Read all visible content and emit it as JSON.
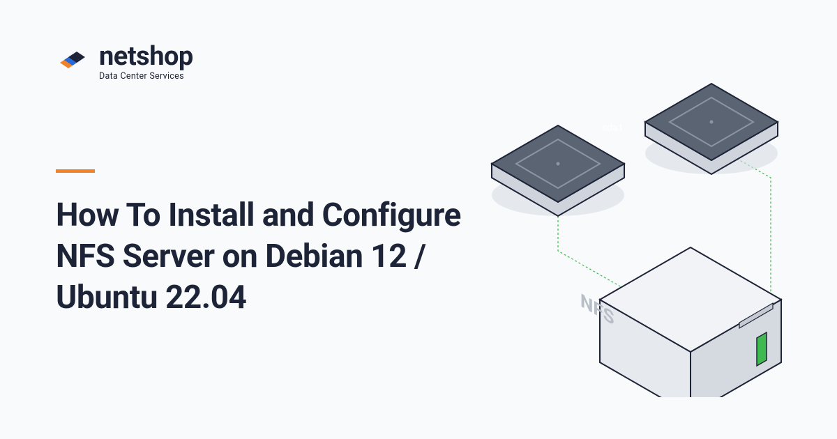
{
  "brand": {
    "name": "netshop",
    "tagline": "Data Center Services",
    "accent_color": "#f08327",
    "logo_primary": "#2769d9",
    "logo_secondary": "#f08327",
    "logo_dark": "#1e2437"
  },
  "article": {
    "title": "How To Install and Configure NFS Server on Debian 12 / Ubuntu 22.04"
  },
  "illustration": {
    "server_label": "NFS",
    "disk_label_1": "sda1"
  }
}
